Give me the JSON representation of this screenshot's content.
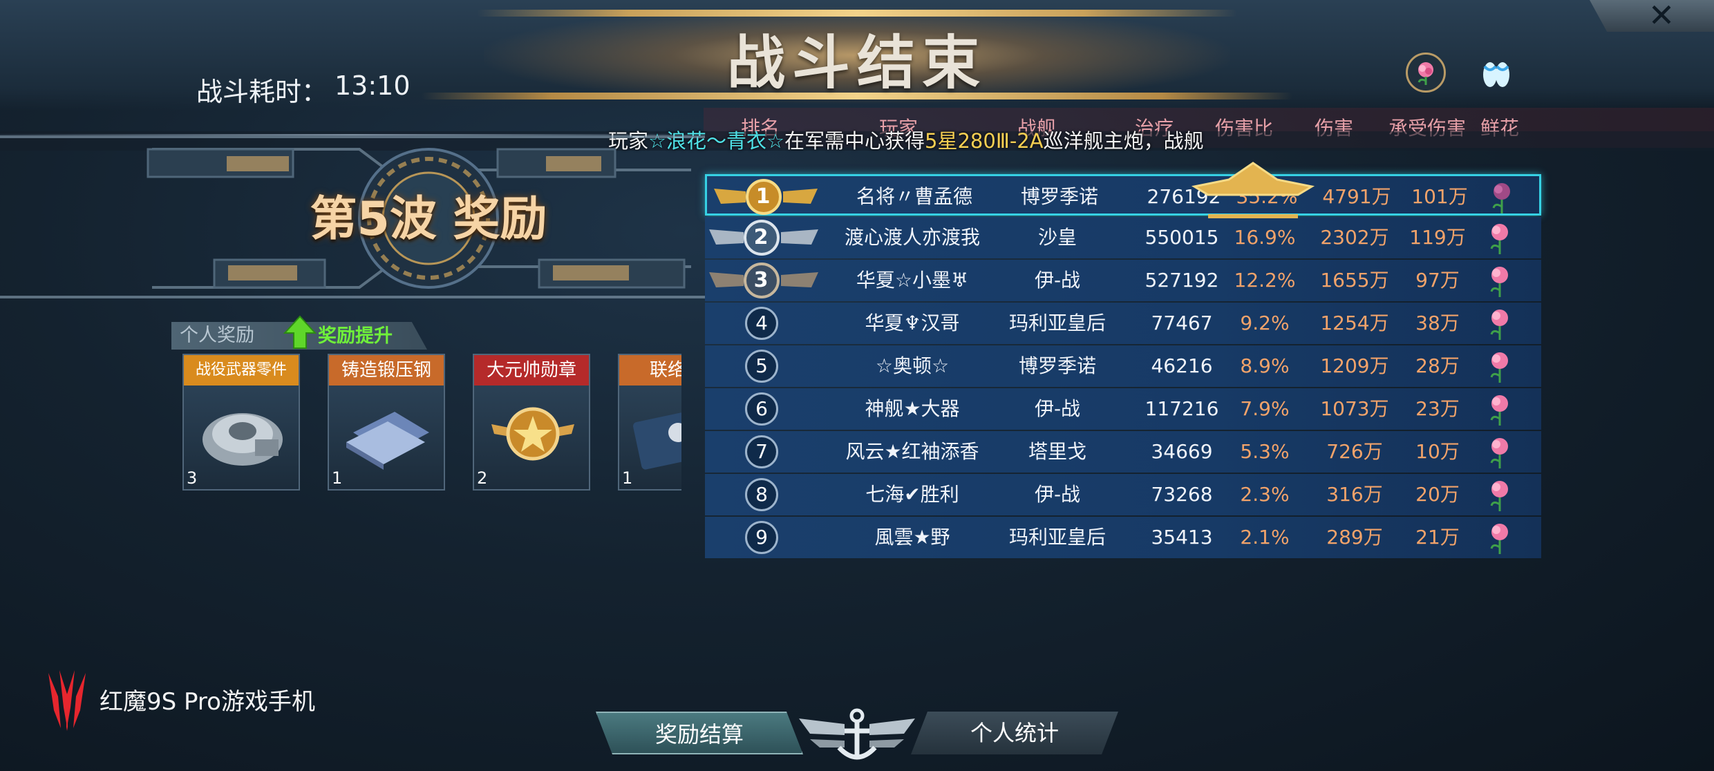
{
  "header": {
    "title": "战斗结束",
    "battle_time_label": "战斗耗时：",
    "battle_time": "13:10"
  },
  "announcement": {
    "part1": "玩家",
    "player": "☆浪花～青衣☆",
    "part2": "在军需中心获得",
    "item": "5星280Ⅲ-2A",
    "part3": "巡洋舰主炮，战舰"
  },
  "wave": {
    "title": "第5波 奖励"
  },
  "personal_rewards": {
    "tab_label": "个人奖励",
    "boost_label": "奖励提升",
    "items": [
      {
        "name": "战役武器零件",
        "count": "3",
        "banner_color": "#d98b1e"
      },
      {
        "name": "铸造锻压钢",
        "count": "1",
        "banner_color": "#c86a2a"
      },
      {
        "name": "大元帅勋章",
        "count": "2",
        "banner_color": "#b52a2a"
      },
      {
        "name": "联络官",
        "count": "1",
        "banner_color": "#c86a2a"
      }
    ]
  },
  "table": {
    "headers": [
      "排名",
      "玩家",
      "战舰",
      "治疗",
      "伤害比",
      "伤害",
      "承受伤害",
      "鲜花"
    ],
    "rows": [
      {
        "rank": "1",
        "name": "名将〃曹孟德",
        "ship": "博罗季诺",
        "heal": "276192",
        "ratio": "35.2%",
        "damage": "4791万",
        "taken": "101万"
      },
      {
        "rank": "2",
        "name": "渡心渡人亦渡我",
        "ship": "沙皇",
        "heal": "550015",
        "ratio": "16.9%",
        "damage": "2302万",
        "taken": "119万"
      },
      {
        "rank": "3",
        "name": "华夏☆小墨♅",
        "ship": "伊-战",
        "heal": "527192",
        "ratio": "12.2%",
        "damage": "1655万",
        "taken": "97万"
      },
      {
        "rank": "4",
        "name": "华夏♆汉哥",
        "ship": "玛利亚皇后",
        "heal": "77467",
        "ratio": "9.2%",
        "damage": "1254万",
        "taken": "38万"
      },
      {
        "rank": "5",
        "name": "☆奥顿☆",
        "ship": "博罗季诺",
        "heal": "46216",
        "ratio": "8.9%",
        "damage": "1209万",
        "taken": "28万"
      },
      {
        "rank": "6",
        "name": "神舰★大器",
        "ship": "伊-战",
        "heal": "117216",
        "ratio": "7.9%",
        "damage": "1073万",
        "taken": "23万"
      },
      {
        "rank": "7",
        "name": "风云★红袖添香",
        "ship": "塔里戈",
        "heal": "34669",
        "ratio": "5.3%",
        "damage": "726万",
        "taken": "10万"
      },
      {
        "rank": "8",
        "name": "七海✔胜利",
        "ship": "伊-战",
        "heal": "73268",
        "ratio": "2.3%",
        "damage": "316万",
        "taken": "20万"
      },
      {
        "rank": "9",
        "name": "風雲★野",
        "ship": "玛利亚皇后",
        "heal": "35413",
        "ratio": "2.1%",
        "damage": "289万",
        "taken": "21万"
      }
    ]
  },
  "bottom": {
    "settle_label": "奖励结算",
    "stats_label": "个人统计"
  },
  "brand": {
    "text": "红魔9S Pro游戏手机"
  },
  "colors": {
    "accent_cyan": "#36d1e4",
    "gold": "#f3d38a",
    "damage_orange": "#f2a36a",
    "header_pink": "#e7a0a8",
    "boost_green": "#6ff03a"
  }
}
